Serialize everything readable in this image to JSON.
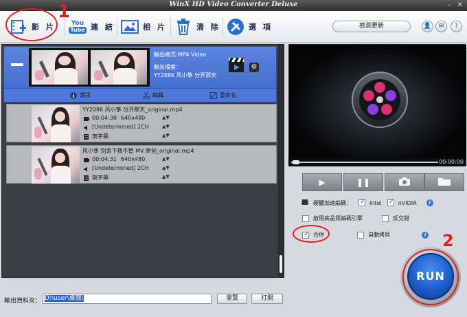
{
  "window": {
    "title": "WinX HD Video Converter Deluxe",
    "min": "–",
    "close": "✕"
  },
  "toolbar": {
    "video_label": "影 片",
    "youtube_icon_top": "You",
    "youtube_icon_bottom": "Tube",
    "url_label": "連 結",
    "photo_label": "相 片",
    "clear_label": "清 除",
    "options_label": "選 項",
    "check_update": "檢測更新",
    "user_icon": "👤",
    "mail_icon": "✉",
    "help_icon": "?"
  },
  "annotations": {
    "one": "1",
    "two": "2"
  },
  "selected": {
    "format": "輸出格式:MP4 Video",
    "file_label": "輸出檔案：",
    "file_name": "YY2086 风小筝 分开那天",
    "actions": {
      "info": "資訊",
      "edit": "編輯",
      "rename": "重命名"
    }
  },
  "items": [
    {
      "name": "YY2086 风小筝 分开那天_original.mp4",
      "duration": "00:04:38",
      "resolution": "640x480",
      "audio": "[Undetermined] 2CH",
      "subtitle": "無字幕"
    },
    {
      "name": "风小筝 别丢下我不管 MV 原创_original.mp4",
      "duration": "00:04:31",
      "resolution": "640x480",
      "audio": "[Undetermined] 2CH",
      "subtitle": "無字幕"
    }
  ],
  "updown": "▲▼",
  "output": {
    "label": "輸出資料夾：",
    "path": "D:\\user\\桌面\\",
    "browse": "瀏覽",
    "open": "打開"
  },
  "player": {
    "time": "00:00:00"
  },
  "options": {
    "hw_label": "硬體加速編碼：",
    "intel": "Intel",
    "nvidia": "nVIDIA",
    "hq_engine": "啟用高品質編碼引擎",
    "deinterlace": "反交錯",
    "merge": "合併",
    "autocopy": "自動拷貝",
    "info_glyph": "i"
  },
  "run": {
    "label": "RUN"
  },
  "colors": {
    "accent": "#3d67c9",
    "annotation": "#e41e1e",
    "run": "#1d5ccc"
  }
}
